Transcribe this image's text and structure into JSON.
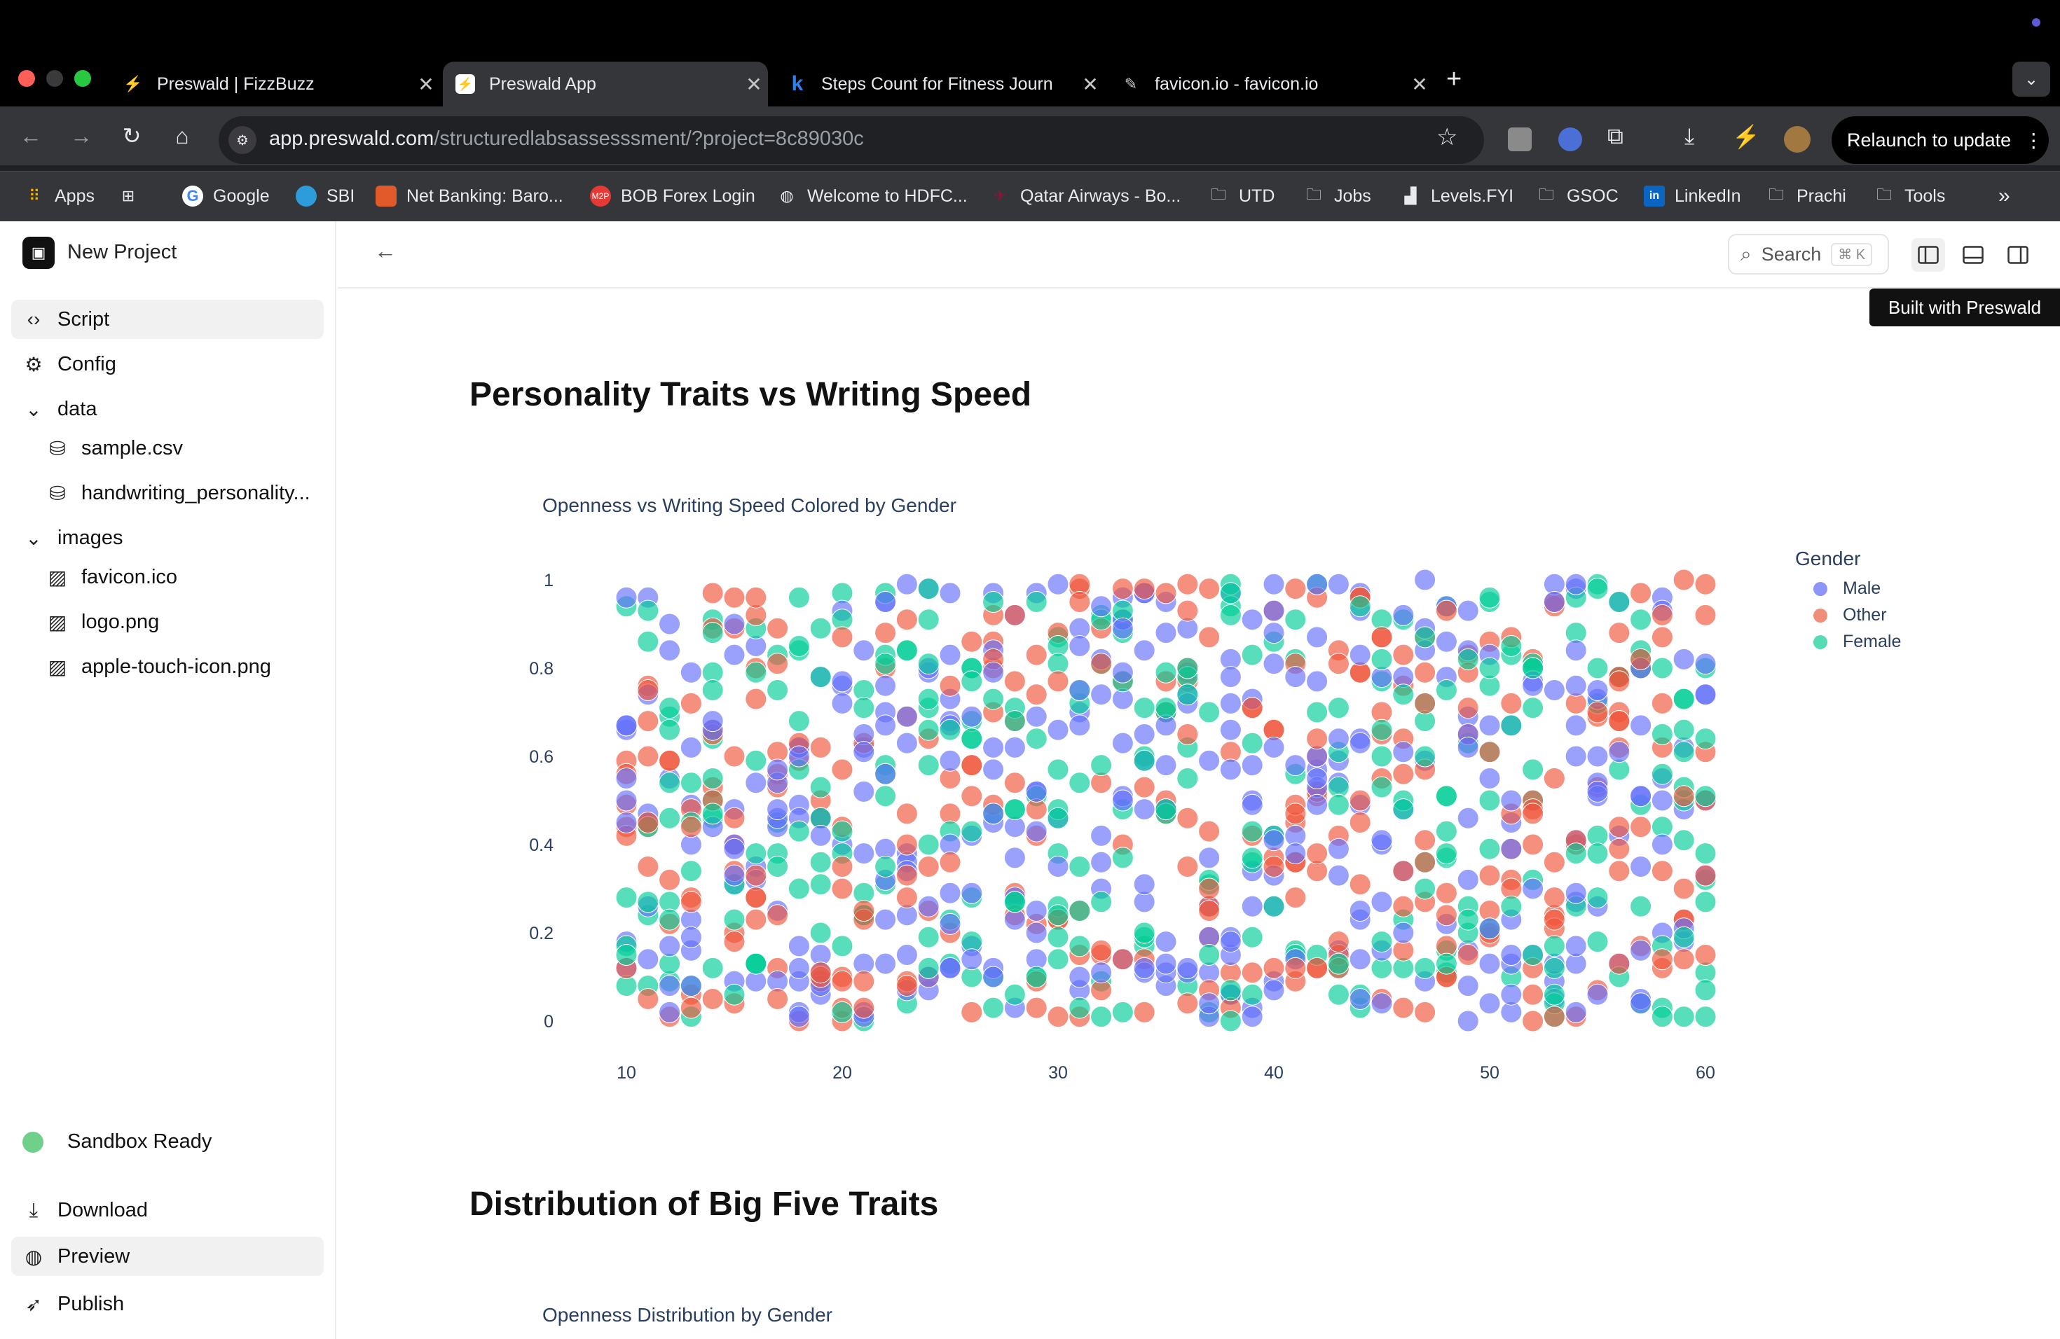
{
  "browser": {
    "tabs": [
      {
        "title": "Preswald | FizzBuzz",
        "icon": "preswald-icon",
        "active": false
      },
      {
        "title": "Preswald App",
        "icon": "preswald-icon",
        "active": true
      },
      {
        "title": "Steps Count for Fitness Journ",
        "icon": "k-icon",
        "active": false
      },
      {
        "title": "favicon.io - favicon.io",
        "icon": "pencil-icon",
        "active": false
      }
    ],
    "url_host": "app.preswald.com",
    "url_path": "/structuredlabsassesssment/?project=8c89030c",
    "relaunch_label": "Relaunch to update",
    "bookmarks": [
      "Apps",
      "Google",
      "SBI",
      "Net Banking: Baro...",
      "BOB Forex Login",
      "Welcome to HDFC...",
      "Qatar Airways - Bo...",
      "UTD",
      "Jobs",
      "Levels.FYI",
      "GSOC",
      "LinkedIn",
      "Prachi",
      "Tools"
    ]
  },
  "sidebar": {
    "project_name": "New Project",
    "items": {
      "script": "Script",
      "config": "Config",
      "data_folder": "data",
      "sample_csv": "sample.csv",
      "handwriting": "handwriting_personality...",
      "images_folder": "images",
      "favicon": "favicon.ico",
      "logo": "logo.png",
      "apple_icon": "apple-touch-icon.png"
    },
    "status": "Sandbox Ready",
    "download": "Download",
    "preview": "Preview",
    "publish": "Publish"
  },
  "header": {
    "search_label": "Search",
    "search_shortcut": "⌘ K",
    "built_with": "Built with Preswald"
  },
  "main": {
    "section1_title": "Personality Traits vs Writing Speed",
    "plot1_title": "Openness vs Writing Speed Colored by Gender",
    "section2_title": "Distribution of Big Five Traits",
    "plot2_title": "Openness Distribution by Gender"
  },
  "chart_data": {
    "type": "scatter",
    "title": "Openness vs Writing Speed Colored by Gender",
    "xlabel": "",
    "ylabel": "",
    "xlim": [
      10,
      60
    ],
    "ylim": [
      0,
      1
    ],
    "x_ticks": [
      10,
      20,
      30,
      40,
      50,
      60
    ],
    "y_ticks": [
      0,
      0.2,
      0.4,
      0.6,
      0.8,
      1
    ],
    "legend_title": "Gender",
    "legend_position": "top-right",
    "grid": false,
    "series": [
      {
        "name": "Male",
        "color": "#636efa"
      },
      {
        "name": "Other",
        "color": "#EF553B"
      },
      {
        "name": "Female",
        "color": "#00cc96"
      }
    ],
    "x_step": 1,
    "points_per_x": 20,
    "seed": 7
  }
}
